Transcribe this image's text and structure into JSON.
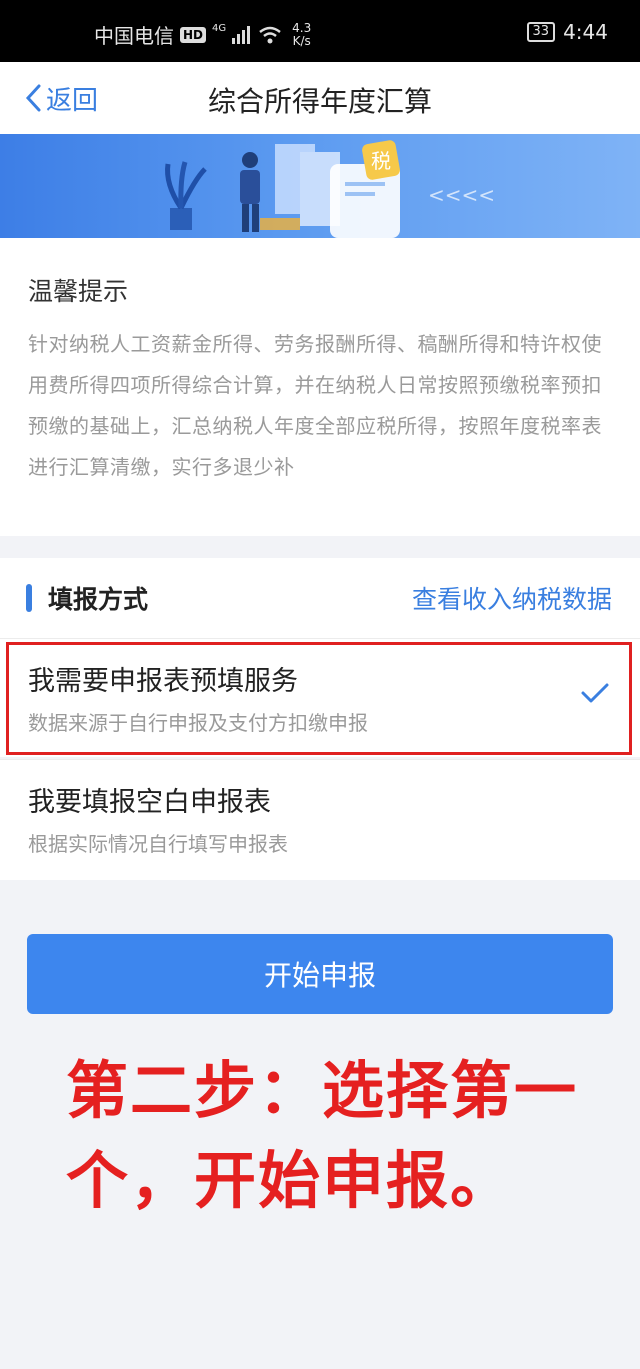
{
  "status_bar": {
    "carrier": "中国电信",
    "hd": "HD",
    "network": "4G",
    "speed_value": "4.3",
    "speed_unit": "K/s",
    "battery": "33",
    "time": "4:44"
  },
  "nav": {
    "back_label": "返回",
    "title": "综合所得年度汇算"
  },
  "banner": {
    "tax_badge": "税"
  },
  "tips": {
    "title": "温馨提示",
    "body": "针对纳税人工资薪金所得、劳务报酬所得、稿酬所得和特许权使用费所得四项所得综合计算，并在纳税人日常按照预缴税率预扣预缴的基础上，汇总纳税人年度全部应税所得，按照年度税率表进行汇算清缴，实行多退少补"
  },
  "method": {
    "title": "填报方式",
    "link": "查看收入纳税数据",
    "options": [
      {
        "title": "我需要申报表预填服务",
        "subtitle": "数据来源于自行申报及支付方扣缴申报",
        "selected": true
      },
      {
        "title": "我要填报空白申报表",
        "subtitle": "根据实际情况自行填写申报表",
        "selected": false
      }
    ]
  },
  "start_button": "开始申报",
  "annotation": "第二步：选择第一个，开始申报。",
  "colors": {
    "accent": "#3a7fe0",
    "button": "#3d86ee",
    "annotation": "#e52020"
  }
}
